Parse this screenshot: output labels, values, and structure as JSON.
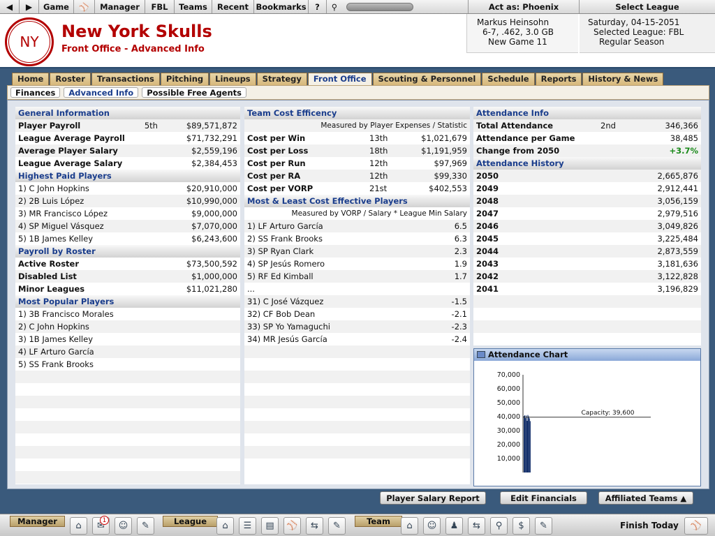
{
  "menubar": {
    "items": [
      "Game",
      "Manager",
      "FBL",
      "Teams",
      "Recent",
      "Bookmarks",
      "?"
    ],
    "act_as": "Act as: Phoenix",
    "select_league": "Select League"
  },
  "header": {
    "logo_text": "NY",
    "team_name": "New York Skulls",
    "page_subtitle": "Front Office - Advanced Info",
    "manager_name": "Markus Heinsohn",
    "manager_record": "6-7, .462, 3.0 GB",
    "manager_game": "New Game 11",
    "date": "Saturday, 04-15-2051",
    "selected_league": "Selected League: FBL",
    "season": "Regular Season"
  },
  "tabs": [
    "Home",
    "Roster",
    "Transactions",
    "Pitching",
    "Lineups",
    "Strategy",
    "Front Office",
    "Scouting & Personnel",
    "Schedule",
    "Reports",
    "History & News"
  ],
  "subtabs": [
    "Finances",
    "Advanced Info",
    "Possible Free Agents"
  ],
  "general": {
    "title": "General Information",
    "rows": [
      {
        "label": "Player Payroll",
        "rank": "5th",
        "value": "$89,571,872"
      },
      {
        "label": "League Average Payroll",
        "rank": "",
        "value": "$71,732,291"
      },
      {
        "label": "Average Player Salary",
        "rank": "",
        "value": "$2,559,196"
      },
      {
        "label": "League Average Salary",
        "rank": "",
        "value": "$2,384,453"
      }
    ]
  },
  "highest_paid": {
    "title": "Highest Paid Players",
    "rows": [
      {
        "label": "1) C John Hopkins",
        "value": "$20,910,000"
      },
      {
        "label": "2) 2B Luis López",
        "value": "$10,990,000"
      },
      {
        "label": "3) MR Francisco López",
        "value": "$9,000,000"
      },
      {
        "label": "4) SP Miguel Vásquez",
        "value": "$7,070,000"
      },
      {
        "label": "5) 1B James Kelley",
        "value": "$6,243,600"
      }
    ]
  },
  "payroll_roster": {
    "title": "Payroll by Roster",
    "rows": [
      {
        "label": "Active Roster",
        "value": "$73,500,592"
      },
      {
        "label": "Disabled List",
        "value": "$1,000,000"
      },
      {
        "label": "Minor Leagues",
        "value": "$11,021,280"
      }
    ]
  },
  "popular": {
    "title": "Most Popular Players",
    "rows": [
      "1) 3B Francisco Morales",
      "2) C John Hopkins",
      "3) 1B James Kelley",
      "4) LF Arturo García",
      "5) SS Frank Brooks"
    ]
  },
  "cost_eff": {
    "title": "Team Cost Efficency",
    "note": "Measured by Player Expenses / Statistic",
    "rows": [
      {
        "label": "Cost per Win",
        "rank": "13th",
        "value": "$1,021,679"
      },
      {
        "label": "Cost per Loss",
        "rank": "18th",
        "value": "$1,191,959"
      },
      {
        "label": "Cost per Run",
        "rank": "12th",
        "value": "$97,969"
      },
      {
        "label": "Cost per RA",
        "rank": "12th",
        "value": "$99,330"
      },
      {
        "label": "Cost per VORP",
        "rank": "21st",
        "value": "$402,553"
      }
    ]
  },
  "most_least": {
    "title": "Most & Least Cost Effective Players",
    "note": "Measured by VORP / Salary * League Min Salary",
    "rows": [
      {
        "label": "1) LF Arturo García",
        "value": "6.5"
      },
      {
        "label": "2) SS Frank Brooks",
        "value": "6.3"
      },
      {
        "label": "3) SP Ryan Clark",
        "value": "2.3"
      },
      {
        "label": "4) SP Jesús Romero",
        "value": "1.9"
      },
      {
        "label": "5) RF Ed Kimball",
        "value": "1.7"
      },
      {
        "label": "...",
        "value": ""
      },
      {
        "label": "31) C José Vázquez",
        "value": "-1.5"
      },
      {
        "label": "32) CF Bob Dean",
        "value": "-2.1"
      },
      {
        "label": "33) SP Yo Yamaguchi",
        "value": "-2.3"
      },
      {
        "label": "34) MR Jesús García",
        "value": "-2.4"
      }
    ]
  },
  "attendance": {
    "title": "Attendance Info",
    "rows": [
      {
        "label": "Total Attendance",
        "rank": "2nd",
        "value": "346,366"
      },
      {
        "label": "Attendance per Game",
        "rank": "",
        "value": "38,485"
      },
      {
        "label": "Change from 2050",
        "rank": "",
        "value": "+3.7%"
      }
    ]
  },
  "history": {
    "title": "Attendance History",
    "rows": [
      {
        "label": "2050",
        "value": "2,665,876"
      },
      {
        "label": "2049",
        "value": "2,912,441"
      },
      {
        "label": "2048",
        "value": "3,056,159"
      },
      {
        "label": "2047",
        "value": "2,979,516"
      },
      {
        "label": "2046",
        "value": "3,049,826"
      },
      {
        "label": "2045",
        "value": "3,225,484"
      },
      {
        "label": "2044",
        "value": "2,873,559"
      },
      {
        "label": "2043",
        "value": "3,181,636"
      },
      {
        "label": "2042",
        "value": "3,122,828"
      },
      {
        "label": "2041",
        "value": "3,196,829"
      }
    ]
  },
  "attendance_chart": {
    "title": "Attendance Chart",
    "capacity_label": "Capacity: 39,600",
    "capacity_value": 39600,
    "ymax": 70000,
    "ticks": [
      "10,000",
      "20,000",
      "30,000",
      "40,000",
      "50,000",
      "60,000",
      "70,000"
    ],
    "tick_values": [
      10000,
      20000,
      30000,
      40000,
      50000,
      60000,
      70000
    ],
    "values": [
      40500,
      41000,
      39000,
      40800,
      37000,
      41200,
      40200,
      38800,
      36800
    ]
  },
  "buttons": {
    "salary_report": "Player Salary Report",
    "edit_financials": "Edit Financials",
    "affiliated": "Affiliated Teams ▲"
  },
  "bottombar": {
    "manager_label": "Manager",
    "league_label": "League",
    "team_label": "Team",
    "finish": "Finish Today",
    "badge": "1"
  }
}
